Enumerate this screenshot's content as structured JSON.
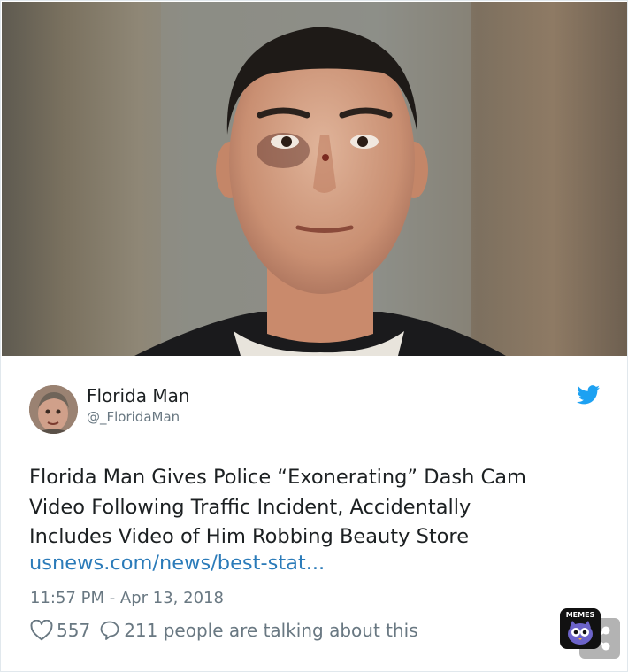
{
  "tweet": {
    "author_name": "Florida Man",
    "author_handle": "@_FloridaMan",
    "text_lines": [
      "Florida Man Gives Police “Exonerating” Dash Cam",
      "Video Following Traffic Incident, Accidentally",
      "Includes Video of Him Robbing Beauty Store"
    ],
    "link_text": "usnews.com/news/best-stat...",
    "timestamp": "11:57 PM - Apr 13, 2018",
    "like_count": "557",
    "reply_count": "211 people are talking about this"
  },
  "icons": {
    "brand": "twitter-bird-icon",
    "like": "heart-icon",
    "reply": "speech-bubble-icon",
    "share": "share-icon"
  },
  "watermark": {
    "label": "MEMES"
  },
  "colors": {
    "link": "#2b7bb9",
    "twitter_blue": "#1da1f2",
    "muted": "#697882",
    "text": "#1c2022"
  }
}
